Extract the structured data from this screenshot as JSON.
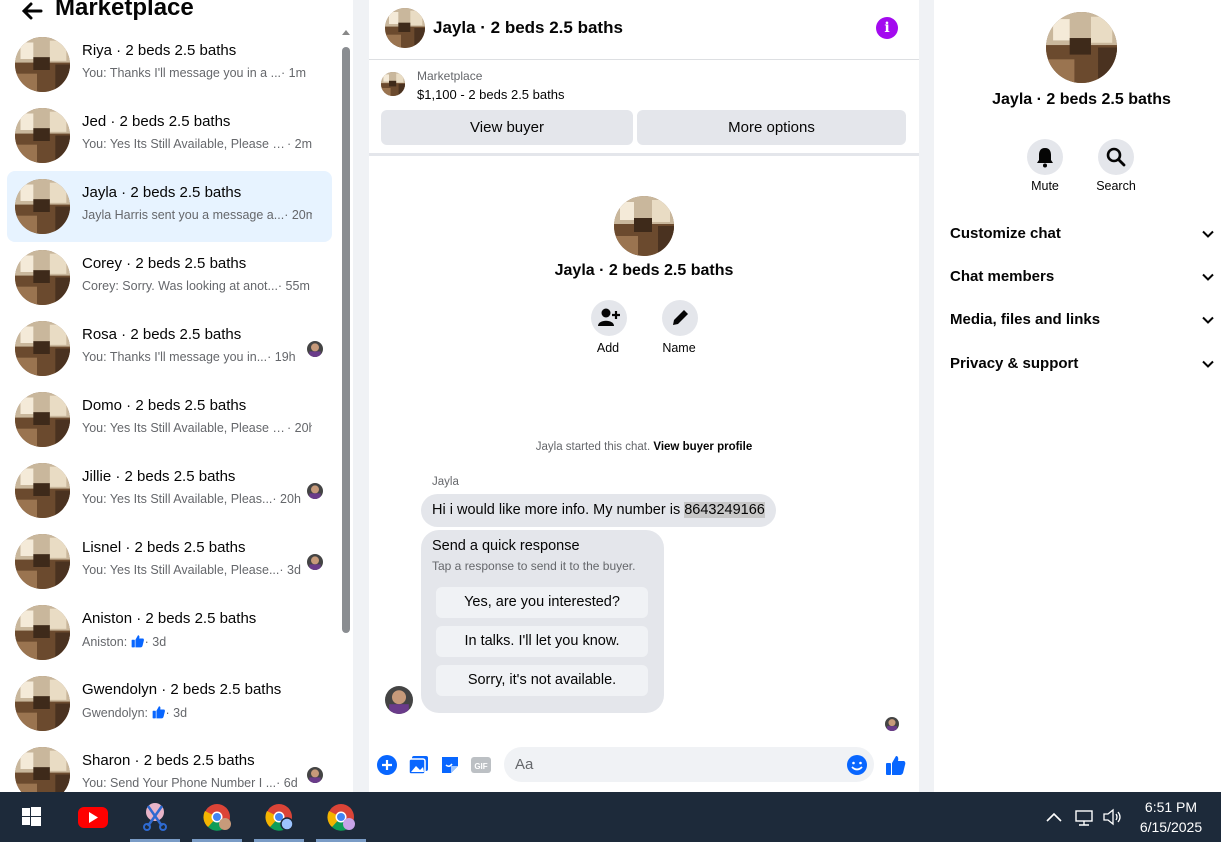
{
  "sidebar": {
    "title": "Marketplace",
    "conversations": [
      {
        "name": "Riya · 2 beds 2.5 baths",
        "preview": "You: Thanks I'll message you in a ...",
        "time": "· 1m",
        "active": false,
        "seen": false
      },
      {
        "name": "Jed · 2 beds 2.5 baths",
        "preview": "You: Yes Its Still Available, Please S...",
        "time": "· 2m",
        "active": false,
        "seen": false
      },
      {
        "name": "Jayla · 2 beds 2.5 baths",
        "preview": "Jayla Harris sent you a message a...",
        "time": "· 20m",
        "active": true,
        "seen": false
      },
      {
        "name": "Corey · 2 beds 2.5 baths",
        "preview": "Corey: Sorry. Was looking at anot...",
        "time": "· 55m",
        "active": false,
        "seen": false
      },
      {
        "name": "Rosa · 2 beds 2.5 baths",
        "preview": "You: Thanks I'll message you in...",
        "time": "· 19h",
        "active": false,
        "seen": true
      },
      {
        "name": "Domo · 2 beds 2.5 baths",
        "preview": "You: Yes Its Still Available, Please S...",
        "time": "· 20h",
        "active": false,
        "seen": false
      },
      {
        "name": "Jillie · 2 beds 2.5 baths",
        "preview": "You: Yes Its Still Available, Pleas...",
        "time": "· 20h",
        "active": false,
        "seen": true
      },
      {
        "name": "Lisnel · 2 beds 2.5 baths",
        "preview": "You: Yes Its Still Available, Please...",
        "time": "· 3d",
        "active": false,
        "seen": true
      },
      {
        "name": "Aniston · 2 beds 2.5 baths",
        "preview": "Aniston:",
        "time": "· 3d",
        "active": false,
        "seen": false,
        "thumb": true
      },
      {
        "name": "Gwendolyn · 2 beds 2.5 baths",
        "preview": "Gwendolyn:",
        "time": "· 3d",
        "active": false,
        "seen": false,
        "thumb": true
      },
      {
        "name": "Sharon · 2 beds 2.5 baths",
        "preview": "You: Send Your Phone Number I ...",
        "time": "· 6d",
        "active": false,
        "seen": true
      }
    ]
  },
  "chat": {
    "title": "Jayla · 2 beds 2.5 baths",
    "marketplace_label": "Marketplace",
    "listing": "$1,100 - 2 beds 2.5 baths",
    "view_buyer": "View buyer",
    "more_options": "More options",
    "intro_name": "Jayla · 2 beds 2.5 baths",
    "add_label": "Add",
    "name_label": "Name",
    "system_text": "Jayla started this chat.",
    "system_link": "View buyer profile",
    "sender": "Jayla",
    "message_text": "Hi i would like more info. My number is ",
    "message_number": "8643249166",
    "quick_title": "Send a quick response",
    "quick_sub": "Tap a response to send it to the buyer.",
    "quick_replies": [
      "Yes, are you interested?",
      "In talks. I'll let you know.",
      "Sorry, it's not available."
    ],
    "composer_placeholder": "Aa"
  },
  "right": {
    "name": "Jayla · 2 beds 2.5 baths",
    "mute": "Mute",
    "search": "Search",
    "sections": [
      "Customize chat",
      "Chat members",
      "Media, files and links",
      "Privacy & support"
    ]
  },
  "taskbar": {
    "time": "6:51 PM",
    "date": "6/15/2025"
  },
  "colors": {
    "accent": "#0866ff",
    "info": "#a30aef",
    "active_row": "#e7f3ff",
    "taskbar": "#1d2a3a"
  }
}
